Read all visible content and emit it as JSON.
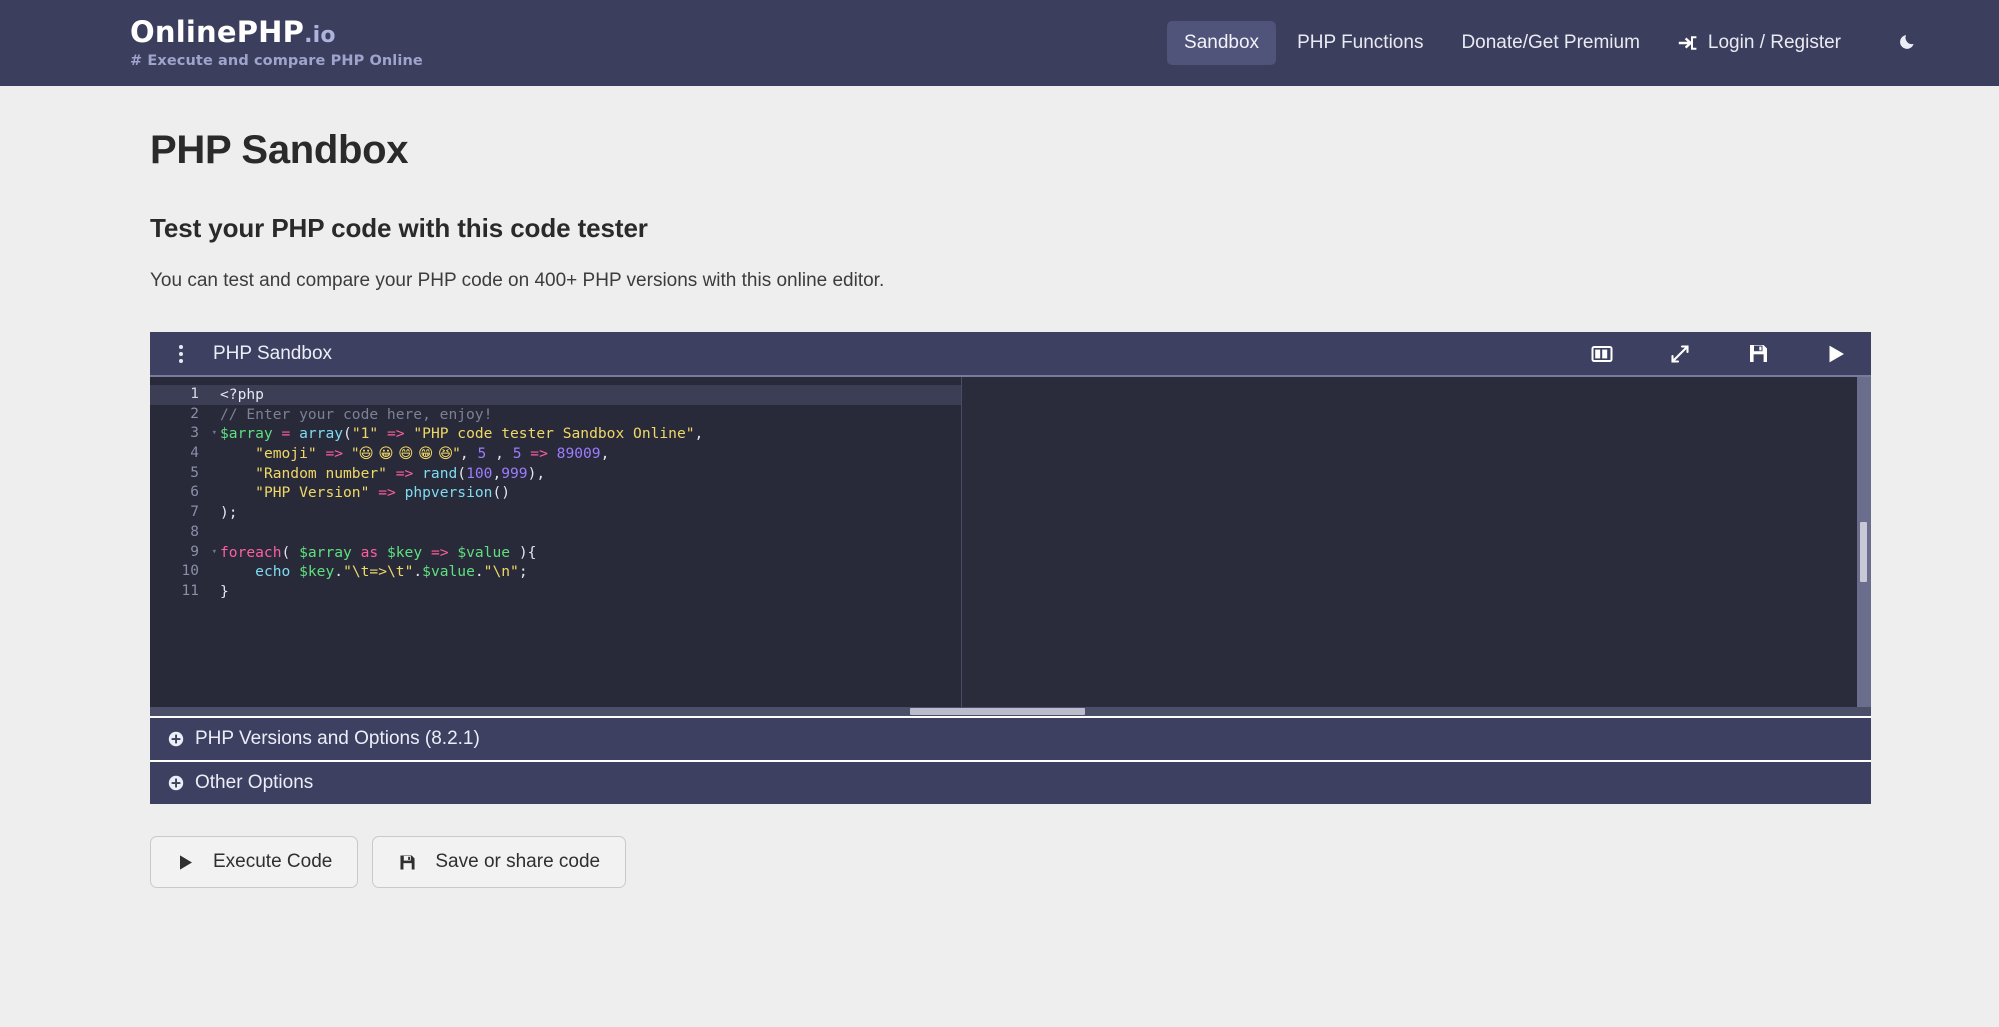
{
  "header": {
    "brand_name": "OnlinePHP",
    "brand_tld": ".io",
    "tagline": "# Execute and compare PHP Online",
    "nav": [
      {
        "label": "Sandbox",
        "active": true,
        "icon": ""
      },
      {
        "label": "PHP Functions",
        "active": false,
        "icon": ""
      },
      {
        "label": "Donate/Get Premium",
        "active": false,
        "icon": ""
      },
      {
        "label": "Login / Register",
        "active": false,
        "icon": "sign-in-icon"
      }
    ],
    "theme_toggle_icon": "moon-icon"
  },
  "main": {
    "page_title": "PHP Sandbox",
    "section_subtitle": "Test your PHP code with this code tester",
    "lead": "You can test and compare your PHP code on 400+ PHP versions with this online editor."
  },
  "editor": {
    "menu_icon": "kebab-menu-icon",
    "title": "PHP Sandbox",
    "tools": [
      {
        "name": "split-view-icon",
        "label": "Split view"
      },
      {
        "name": "expand-icon",
        "label": "Expand"
      },
      {
        "name": "save-icon",
        "label": "Save"
      },
      {
        "name": "run-icon",
        "label": "Run"
      }
    ],
    "active_line": 1,
    "fold_lines": [
      3,
      9
    ],
    "line_numbers": [
      1,
      2,
      3,
      4,
      5,
      6,
      7,
      8,
      9,
      10,
      11
    ],
    "code_lines": [
      {
        "n": 1,
        "tokens": [
          {
            "t": "tag",
            "v": "<?php"
          }
        ]
      },
      {
        "n": 2,
        "tokens": [
          {
            "t": "com",
            "v": "// Enter your code here, enjoy!"
          }
        ]
      },
      {
        "n": 3,
        "tokens": [
          {
            "t": "var",
            "v": "$array"
          },
          {
            "t": "plain",
            "v": " "
          },
          {
            "t": "op",
            "v": "="
          },
          {
            "t": "plain",
            "v": " "
          },
          {
            "t": "fn",
            "v": "array"
          },
          {
            "t": "punc",
            "v": "("
          },
          {
            "t": "str",
            "v": "\"1\""
          },
          {
            "t": "plain",
            "v": " "
          },
          {
            "t": "op",
            "v": "=>"
          },
          {
            "t": "plain",
            "v": " "
          },
          {
            "t": "str",
            "v": "\"PHP code tester Sandbox Online\""
          },
          {
            "t": "punc",
            "v": ","
          }
        ]
      },
      {
        "n": 4,
        "tokens": [
          {
            "t": "plain",
            "v": "    "
          },
          {
            "t": "str",
            "v": "\"emoji\""
          },
          {
            "t": "plain",
            "v": " "
          },
          {
            "t": "op",
            "v": "=>"
          },
          {
            "t": "plain",
            "v": " "
          },
          {
            "t": "str",
            "v": "\"😃 😀 😄 😁 😆\""
          },
          {
            "t": "punc",
            "v": ","
          },
          {
            "t": "plain",
            "v": " "
          },
          {
            "t": "num",
            "v": "5"
          },
          {
            "t": "plain",
            "v": " "
          },
          {
            "t": "punc",
            "v": ","
          },
          {
            "t": "plain",
            "v": " "
          },
          {
            "t": "num",
            "v": "5"
          },
          {
            "t": "plain",
            "v": " "
          },
          {
            "t": "op",
            "v": "=>"
          },
          {
            "t": "plain",
            "v": " "
          },
          {
            "t": "num",
            "v": "89009"
          },
          {
            "t": "punc",
            "v": ","
          }
        ]
      },
      {
        "n": 5,
        "tokens": [
          {
            "t": "plain",
            "v": "    "
          },
          {
            "t": "str",
            "v": "\"Random number\""
          },
          {
            "t": "plain",
            "v": " "
          },
          {
            "t": "op",
            "v": "=>"
          },
          {
            "t": "plain",
            "v": " "
          },
          {
            "t": "fn",
            "v": "rand"
          },
          {
            "t": "punc",
            "v": "("
          },
          {
            "t": "num",
            "v": "100"
          },
          {
            "t": "punc",
            "v": ","
          },
          {
            "t": "num",
            "v": "999"
          },
          {
            "t": "punc",
            "v": "),"
          }
        ]
      },
      {
        "n": 6,
        "tokens": [
          {
            "t": "plain",
            "v": "    "
          },
          {
            "t": "str",
            "v": "\"PHP Version\""
          },
          {
            "t": "plain",
            "v": " "
          },
          {
            "t": "op",
            "v": "=>"
          },
          {
            "t": "plain",
            "v": " "
          },
          {
            "t": "fn",
            "v": "phpversion"
          },
          {
            "t": "punc",
            "v": "()"
          }
        ]
      },
      {
        "n": 7,
        "tokens": [
          {
            "t": "punc",
            "v": ");"
          }
        ]
      },
      {
        "n": 8,
        "tokens": [
          {
            "t": "plain",
            "v": ""
          }
        ]
      },
      {
        "n": 9,
        "tokens": [
          {
            "t": "kw",
            "v": "foreach"
          },
          {
            "t": "punc",
            "v": "( "
          },
          {
            "t": "var",
            "v": "$array"
          },
          {
            "t": "plain",
            "v": " "
          },
          {
            "t": "kw",
            "v": "as"
          },
          {
            "t": "plain",
            "v": " "
          },
          {
            "t": "var",
            "v": "$key"
          },
          {
            "t": "plain",
            "v": " "
          },
          {
            "t": "op",
            "v": "=>"
          },
          {
            "t": "plain",
            "v": " "
          },
          {
            "t": "var",
            "v": "$value"
          },
          {
            "t": "punc",
            "v": " ){"
          }
        ]
      },
      {
        "n": 10,
        "tokens": [
          {
            "t": "plain",
            "v": "    "
          },
          {
            "t": "fn",
            "v": "echo"
          },
          {
            "t": "plain",
            "v": " "
          },
          {
            "t": "var",
            "v": "$key"
          },
          {
            "t": "punc",
            "v": "."
          },
          {
            "t": "str",
            "v": "\"\\t=>\\t\""
          },
          {
            "t": "punc",
            "v": "."
          },
          {
            "t": "var",
            "v": "$value"
          },
          {
            "t": "punc",
            "v": "."
          },
          {
            "t": "str",
            "v": "\"\\n\""
          },
          {
            "t": "punc",
            "v": ";"
          }
        ]
      },
      {
        "n": 11,
        "tokens": [
          {
            "t": "punc",
            "v": "}"
          }
        ]
      }
    ]
  },
  "accordions": [
    {
      "label": "PHP Versions and Options (8.2.1)",
      "icon": "plus-circle-icon",
      "php_version": "8.2.1"
    },
    {
      "label": "Other Options",
      "icon": "plus-circle-icon"
    }
  ],
  "actions": [
    {
      "label": "Execute Code",
      "icon": "play-icon"
    },
    {
      "label": "Save or share code",
      "icon": "save-icon"
    }
  ],
  "colors": {
    "header_bg": "#3b3e5c",
    "nav_active_bg": "#50537a",
    "page_bg": "#eeeeee",
    "editor_header_bg": "#3d4060",
    "editor_bg": "#282a39",
    "accordion_bg": "#3d4060"
  }
}
